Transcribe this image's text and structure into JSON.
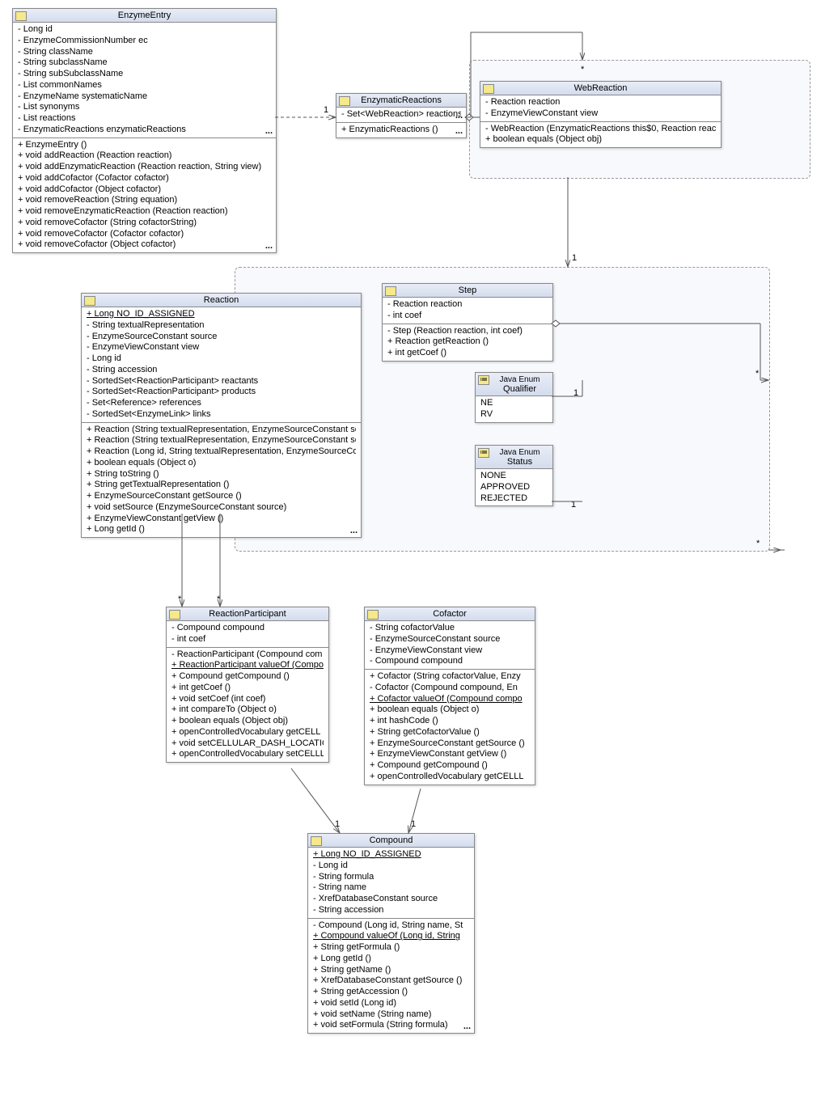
{
  "classes": {
    "EnzymeEntry": {
      "name": "EnzymeEntry",
      "attrs": [
        "- Long id",
        "- EnzymeCommissionNumber ec",
        "- String className",
        "- String subclassName",
        "- String subSubclassName",
        "- List commonNames",
        "- EnzymeName systematicName",
        "- List synonyms",
        "- List reactions",
        "- EnzymaticReactions enzymaticReactions"
      ],
      "ops": [
        "+ EnzymeEntry ()",
        "+ void addReaction (Reaction reaction)",
        "+ void addEnzymaticReaction (Reaction reaction, String view)",
        "+ void addCofactor (Cofactor cofactor)",
        "+ void addCofactor (Object cofactor)",
        "+ void removeReaction (String equation)",
        "+ void removeEnzymaticReaction (Reaction reaction)",
        "+ void removeCofactor (String cofactorString)",
        "+ void removeCofactor (Cofactor cofactor)",
        "+ void removeCofactor (Object cofactor)"
      ]
    },
    "EnzymaticReactions": {
      "name": "EnzymaticReactions",
      "attrs": [
        "- Set<WebReaction> reactions"
      ],
      "ops": [
        "+ EnzymaticReactions ()"
      ]
    },
    "WebReaction": {
      "name": "WebReaction",
      "attrs": [
        "- Reaction reaction",
        "- EnzymeViewConstant view"
      ],
      "ops": [
        "- WebReaction (EnzymaticReactions this$0, Reaction react",
        "+ boolean equals (Object obj)"
      ]
    },
    "Reaction": {
      "name": "Reaction",
      "underlined0": "+ Long NO_ID_ASSIGNED",
      "attrs": [
        "- String textualRepresentation",
        "- EnzymeSourceConstant source",
        "- EnzymeViewConstant view",
        "- Long id",
        "- String accession",
        "- SortedSet<ReactionParticipant> reactants",
        "- SortedSet<ReactionParticipant> products",
        "- Set<Reference> references",
        "- SortedSet<EnzymeLink> links"
      ],
      "ops": [
        "+ Reaction (String textualRepresentation, EnzymeSourceConstant source",
        "+ Reaction (String textualRepresentation, EnzymeSourceConstant source",
        "+ Reaction (Long id, String textualRepresentation, EnzymeSourceConstan",
        "+ boolean equals (Object o)",
        "+ String toString ()",
        "+ String getTextualRepresentation ()",
        "+ EnzymeSourceConstant getSource ()",
        "+ void setSource (EnzymeSourceConstant source)",
        "+ EnzymeViewConstant getView ()",
        "+ Long getId ()"
      ]
    },
    "Step": {
      "name": "Step",
      "attrs": [
        "- Reaction reaction",
        "- int coef"
      ],
      "ops": [
        "- Step (Reaction reaction, int coef)",
        "+ Reaction getReaction ()",
        "+ int getCoef ()"
      ]
    },
    "Qualifier": {
      "prefix": "Java Enum",
      "name": "Qualifier",
      "vals": [
        "NE",
        "RV"
      ]
    },
    "Status": {
      "prefix": "Java Enum",
      "name": "Status",
      "vals": [
        "NONE",
        "APPROVED",
        "REJECTED"
      ]
    },
    "ReactionParticipant": {
      "name": "ReactionParticipant",
      "attrs": [
        "- Compound compound",
        "- int coef"
      ],
      "ops": [
        "- ReactionParticipant (Compound com",
        "+ ReactionParticipant valueOf (Compo",
        "+ Compound getCompound ()",
        "+ int getCoef ()",
        "+ void setCoef (int coef)",
        "+ int compareTo (Object o)",
        "+ boolean equals (Object obj)",
        "+ openControlledVocabulary getCELL",
        "+ void setCELLULAR_DASH_LOCATION",
        "+ openControlledVocabulary setCELLL"
      ],
      "ops_ul_idx": 1
    },
    "Cofactor": {
      "name": "Cofactor",
      "attrs": [
        "- String cofactorValue",
        "- EnzymeSourceConstant source",
        "- EnzymeViewConstant view",
        "- Compound compound"
      ],
      "ops": [
        "+  Cofactor (String cofactorValue, Enzy",
        "- Cofactor (Compound compound, En",
        "+ Cofactor valueOf (Compound compo",
        "+ boolean equals (Object o)",
        "+ int hashCode ()",
        "+ String getCofactorValue ()",
        "+ EnzymeSourceConstant getSource ()",
        "+ EnzymeViewConstant getView ()",
        "+ Compound getCompound ()",
        "+ openControlledVocabulary getCELLL"
      ],
      "ops_ul_idx": 2
    },
    "Compound": {
      "name": "Compound",
      "underlined0": "+ Long NO_ID_ASSIGNED",
      "attrs": [
        "- Long id",
        "- String formula",
        "- String name",
        "- XrefDatabaseConstant source",
        "- String accession"
      ],
      "ops": [
        "-  Compound (Long id, String name, St",
        "+ Compound valueOf (Long id, String",
        "+ String getFormula ()",
        "+ Long getId ()",
        "+ String getName ()",
        "+ XrefDatabaseConstant getSource ()",
        "+ String getAccession ()",
        "+ void setId (Long id)",
        "+ void setName (String name)",
        "+ void setFormula (String formula)"
      ],
      "ops_ul_idx": 1
    }
  },
  "mult": {
    "m1": "1",
    "m2": "*",
    "m3": "1",
    "m4": "*",
    "m5": "*",
    "m6": "1",
    "m7": "1",
    "m8": "1",
    "m9": "1",
    "m10": "*",
    "m11": "1",
    "m12": "*"
  }
}
